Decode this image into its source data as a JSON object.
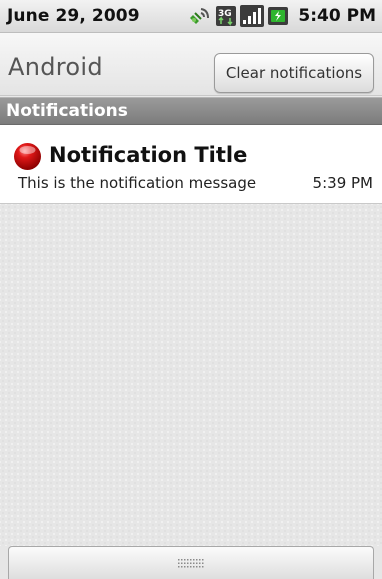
{
  "status_bar": {
    "date": "June 29, 2009",
    "time": "5:40 PM",
    "icons": [
      "gps-icon",
      "3g-data-icon",
      "signal-icon",
      "battery-icon"
    ]
  },
  "title_bar": {
    "app_name": "Android",
    "clear_button_label": "Clear notifications"
  },
  "section": {
    "header": "Notifications"
  },
  "notification": {
    "icon": "red-ball-icon",
    "title": "Notification Title",
    "message": "This is the notification message",
    "time": "5:39 PM"
  },
  "colors": {
    "section_header": "#8a8a8a",
    "notification_icon": "#cc1010",
    "battery_accent": "#2fb52f"
  }
}
